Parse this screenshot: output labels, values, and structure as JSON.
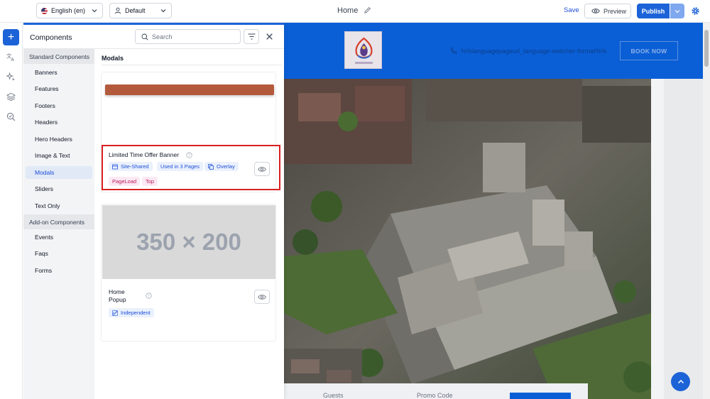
{
  "topbar": {
    "language": "English (en)",
    "variant": "Default",
    "page_title": "Home",
    "save_label": "Save",
    "preview_label": "Preview",
    "publish_label": "Publish"
  },
  "panel": {
    "title": "Components",
    "search_placeholder": "Search",
    "groups": [
      {
        "label": "Standard Components",
        "items": [
          "Banners",
          "Features",
          "Footers",
          "Headers",
          "Hero Headers",
          "Image & Text",
          "Modals",
          "Sliders",
          "Text Only"
        ]
      },
      {
        "label": "Add-on Components",
        "items": [
          "Events",
          "Faqs",
          "Forms"
        ]
      }
    ],
    "active_item": "Modals",
    "section_title": "Modals",
    "cards": [
      {
        "name": "Limited Time Offer Banner",
        "badges_blue": [
          "Site-Shared",
          "Used in 3 Pages",
          "Overlay"
        ],
        "badges_pink": [
          "PageLoad",
          "Top"
        ]
      },
      {
        "name_line1": "Home",
        "name_line2": "Popup",
        "thumb_text": "350 × 200",
        "badges_blue": [
          "Independent"
        ]
      }
    ]
  },
  "site": {
    "header_text": "%%languagepageurl_language-switcher-format%%",
    "book_label": "BOOK NOW",
    "booking_guests": "Guests",
    "booking_promo": "Promo Code"
  },
  "colors": {
    "accent": "#1d63d8",
    "highlight": "#d92020",
    "site_header": "#0b5fd6"
  }
}
